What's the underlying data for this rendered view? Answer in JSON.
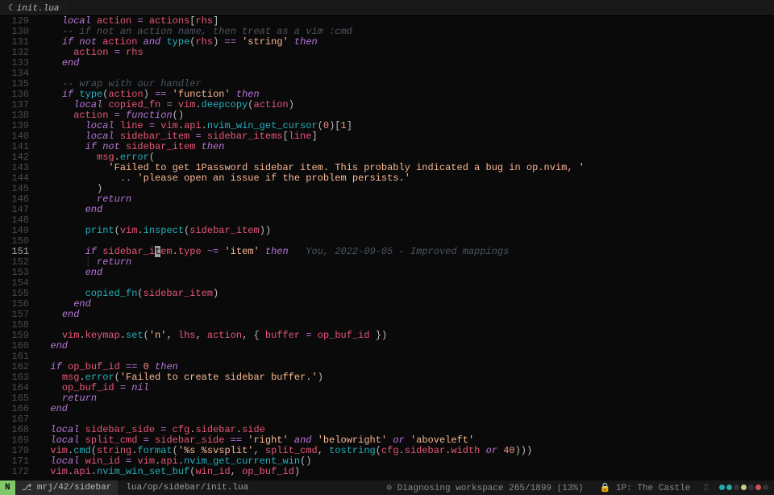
{
  "tab": {
    "icon": "☾",
    "label": "init.lua"
  },
  "lines": [
    {
      "n": 129,
      "html": "    <span class='kw'>local</span> <span class='ident'>action</span> <span class='op'>=</span> <span class='ident'>actions</span><span class='punct'>[</span><span class='ident'>rhs</span><span class='punct'>]</span>"
    },
    {
      "n": 130,
      "html": "    <span class='comment'>-- if not an action name, then treat as a vim :cmd</span>"
    },
    {
      "n": 131,
      "html": "    <span class='kw'>if</span> <span class='kw'>not</span> <span class='ident'>action</span> <span class='kw'>and</span> <span class='func'>type</span><span class='punct'>(</span><span class='ident'>rhs</span><span class='punct'>)</span> <span class='op'>==</span> <span class='str'>'string'</span> <span class='kw'>then</span>"
    },
    {
      "n": 132,
      "html": "      <span class='ident'>action</span> <span class='op'>=</span> <span class='ident'>rhs</span>"
    },
    {
      "n": 133,
      "html": "    <span class='kw'>end</span>"
    },
    {
      "n": 134,
      "html": ""
    },
    {
      "n": 135,
      "html": "    <span class='comment'>-- wrap with our handler</span>"
    },
    {
      "n": 136,
      "html": "    <span class='kw'>if</span> <span class='func'>type</span><span class='punct'>(</span><span class='ident'>action</span><span class='punct'>)</span> <span class='op'>==</span> <span class='str'>'function'</span> <span class='kw'>then</span>"
    },
    {
      "n": 137,
      "html": "      <span class='kw'>local</span> <span class='ident'>copied_fn</span> <span class='op'>=</span> <span class='ident'>vim</span><span class='punct'>.</span><span class='func'>deepcopy</span><span class='punct'>(</span><span class='ident'>action</span><span class='punct'>)</span>"
    },
    {
      "n": 138,
      "html": "      <span class='ident'>action</span> <span class='op'>=</span> <span class='kw'>function</span><span class='punct'>()</span>"
    },
    {
      "n": 139,
      "html": "        <span class='kw'>local</span> <span class='ident'>line</span> <span class='op'>=</span> <span class='ident'>vim</span><span class='punct'>.</span><span class='member'>api</span><span class='punct'>.</span><span class='func'>nvim_win_get_cursor</span><span class='punct'>(</span><span class='num'>0</span><span class='punct'>)[</span><span class='num'>1</span><span class='punct'>]</span>"
    },
    {
      "n": 140,
      "html": "        <span class='kw'>local</span> <span class='ident'>sidebar_item</span> <span class='op'>=</span> <span class='ident'>sidebar_items</span><span class='punct'>[</span><span class='ident'>line</span><span class='punct'>]</span>"
    },
    {
      "n": 141,
      "html": "        <span class='kw'>if</span> <span class='kw'>not</span> <span class='ident'>sidebar_item</span> <span class='kw'>then</span>"
    },
    {
      "n": 142,
      "html": "          <span class='ident'>msg</span><span class='punct'>.</span><span class='func'>error</span><span class='punct'>(</span>"
    },
    {
      "n": 143,
      "html": "            <span class='str'>'Failed to get 1Password sidebar item. This probably indicated a bug in op.nvim, '</span>"
    },
    {
      "n": 144,
      "html": "              <span class='op'>..</span> <span class='str'>'please open an issue if the problem persists.'</span>"
    },
    {
      "n": 145,
      "html": "          <span class='punct'>)</span>"
    },
    {
      "n": 146,
      "html": "          <span class='kw'>return</span>"
    },
    {
      "n": 147,
      "html": "        <span class='kw'>end</span>"
    },
    {
      "n": 148,
      "html": ""
    },
    {
      "n": 149,
      "html": "        <span class='func'>print</span><span class='punct'>(</span><span class='ident'>vim</span><span class='punct'>.</span><span class='func'>inspect</span><span class='punct'>(</span><span class='ident'>sidebar_item</span><span class='punct'>))</span>"
    },
    {
      "n": 150,
      "html": ""
    },
    {
      "n": 151,
      "current": true,
      "html": "        <span class='kw'>if</span> <span class='ident'>sidebar_i</span><span class='cursor'>t</span><span class='ident'>em</span><span class='punct'>.</span><span class='member'>type</span> <span class='op'>~=</span> <span class='str'>'item'</span> <span class='kw'>then</span>   <span class='blame'>You, 2022-09-05 - Improved mappings</span>"
    },
    {
      "n": 152,
      "html": "        <span class='indent-guide'>│</span> <span class='kw'>return</span>"
    },
    {
      "n": 153,
      "html": "        <span class='kw'>end</span>"
    },
    {
      "n": 154,
      "html": ""
    },
    {
      "n": 155,
      "html": "        <span class='func'>copied_fn</span><span class='punct'>(</span><span class='ident'>sidebar_item</span><span class='punct'>)</span>"
    },
    {
      "n": 156,
      "html": "      <span class='kw'>end</span>"
    },
    {
      "n": 157,
      "html": "    <span class='kw'>end</span>"
    },
    {
      "n": 158,
      "html": ""
    },
    {
      "n": 159,
      "html": "    <span class='ident'>vim</span><span class='punct'>.</span><span class='member'>keymap</span><span class='punct'>.</span><span class='func'>set</span><span class='punct'>(</span><span class='str'>'n'</span><span class='punct'>,</span> <span class='ident'>lhs</span><span class='punct'>,</span> <span class='ident'>action</span><span class='punct'>,</span> <span class='punct'>{</span> <span class='ident'>buffer</span> <span class='op'>=</span> <span class='ident'>op_buf_id</span> <span class='punct'>})</span>"
    },
    {
      "n": 160,
      "html": "  <span class='kw'>end</span>"
    },
    {
      "n": 161,
      "html": ""
    },
    {
      "n": 162,
      "html": "  <span class='kw'>if</span> <span class='ident'>op_buf_id</span> <span class='op'>==</span> <span class='num'>0</span> <span class='kw'>then</span>"
    },
    {
      "n": 163,
      "html": "    <span class='ident'>msg</span><span class='punct'>.</span><span class='func'>error</span><span class='punct'>(</span><span class='str'>'Failed to create sidebar buffer.'</span><span class='punct'>)</span>"
    },
    {
      "n": 164,
      "html": "    <span class='ident'>op_buf_id</span> <span class='op'>=</span> <span class='kw'>nil</span>"
    },
    {
      "n": 165,
      "html": "    <span class='kw'>return</span>"
    },
    {
      "n": 166,
      "html": "  <span class='kw'>end</span>"
    },
    {
      "n": 167,
      "html": ""
    },
    {
      "n": 168,
      "html": "  <span class='kw'>local</span> <span class='ident'>sidebar_side</span> <span class='op'>=</span> <span class='ident'>cfg</span><span class='punct'>.</span><span class='member'>sidebar</span><span class='punct'>.</span><span class='member'>side</span>"
    },
    {
      "n": 169,
      "html": "  <span class='kw'>local</span> <span class='ident'>split_cmd</span> <span class='op'>=</span> <span class='ident'>sidebar_side</span> <span class='op'>==</span> <span class='str'>'right'</span> <span class='kw'>and</span> <span class='str'>'belowright'</span> <span class='kw'>or</span> <span class='str'>'aboveleft'</span>"
    },
    {
      "n": 170,
      "html": "  <span class='ident'>vim</span><span class='punct'>.</span><span class='func'>cmd</span><span class='punct'>(</span><span class='ident'>string</span><span class='punct'>.</span><span class='func'>format</span><span class='punct'>(</span><span class='str'>'%s %svsplit'</span><span class='punct'>,</span> <span class='ident'>split_cmd</span><span class='punct'>,</span> <span class='func'>tostring</span><span class='punct'>(</span><span class='ident'>cfg</span><span class='punct'>.</span><span class='member'>sidebar</span><span class='punct'>.</span><span class='member'>width</span> <span class='kw'>or</span> <span class='num'>40</span><span class='punct'>)))</span>"
    },
    {
      "n": 171,
      "html": "  <span class='kw'>local</span> <span class='ident'>win_id</span> <span class='op'>=</span> <span class='ident'>vim</span><span class='punct'>.</span><span class='member'>api</span><span class='punct'>.</span><span class='func'>nvim_get_current_win</span><span class='punct'>()</span>"
    },
    {
      "n": 172,
      "html": "  <span class='ident'>vim</span><span class='punct'>.</span><span class='member'>api</span><span class='punct'>.</span><span class='func'>nvim_win_set_buf</span><span class='punct'>(</span><span class='ident'>win_id</span><span class='punct'>,</span> <span class='ident'>op_buf_id</span><span class='punct'>)</span>"
    }
  ],
  "status": {
    "mode": "N",
    "branch_icon": "⎇",
    "branch": "mrj/42/sidebar",
    "file": "lua/op/sidebar/init.lua",
    "diag_icon": "⊙",
    "diag": "Diagnosing workspace 265/1899 (13%)",
    "onepass_icon": "🔒",
    "onepass": "1P: The Castle",
    "icons": "♖"
  }
}
